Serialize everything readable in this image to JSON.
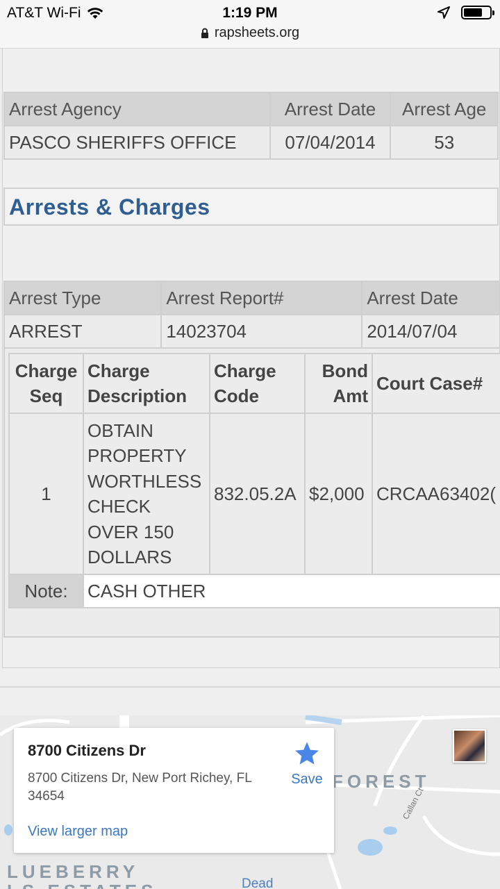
{
  "status_bar": {
    "carrier": "AT&T Wi-Fi",
    "time": "1:19 PM",
    "url": "rapsheets.org"
  },
  "agency_table": {
    "headers": [
      "Arrest Agency",
      "Arrest Date",
      "Arrest Age"
    ],
    "row": [
      "PASCO SHERIFFS OFFICE",
      "07/04/2014",
      "53"
    ]
  },
  "section_title": "Arrests & Charges",
  "arrest_table": {
    "headers": [
      "Arrest Type",
      "Arrest Report#",
      "Arrest Date"
    ],
    "row": [
      "ARREST",
      "14023704",
      "2014/07/04"
    ]
  },
  "charges_table": {
    "headers": [
      "Charge Seq",
      "Charge Description",
      "Charge Code",
      "Bond Amt",
      "Court Case#"
    ],
    "row": {
      "seq": "1",
      "description": "OBTAIN PROPERTY WORTHLESS CHECK OVER 150 DOLLARS",
      "code": "832.05.2A",
      "bond": "$2,000",
      "court_case": "CRCAA63402("
    },
    "note_label": "Note:",
    "note_value": "CASH OTHER"
  },
  "map": {
    "place_title": "8700 Citizens Dr",
    "place_address": "8700 Citizens Dr, New Port Richey, FL 34654",
    "save_label": "Save",
    "view_larger_label": "View larger map",
    "labels": [
      "FOREST",
      "LUEBERRY",
      "LS ESTATES",
      "Dead",
      "Callan Ct"
    ],
    "star_color": "#4a86e8"
  }
}
